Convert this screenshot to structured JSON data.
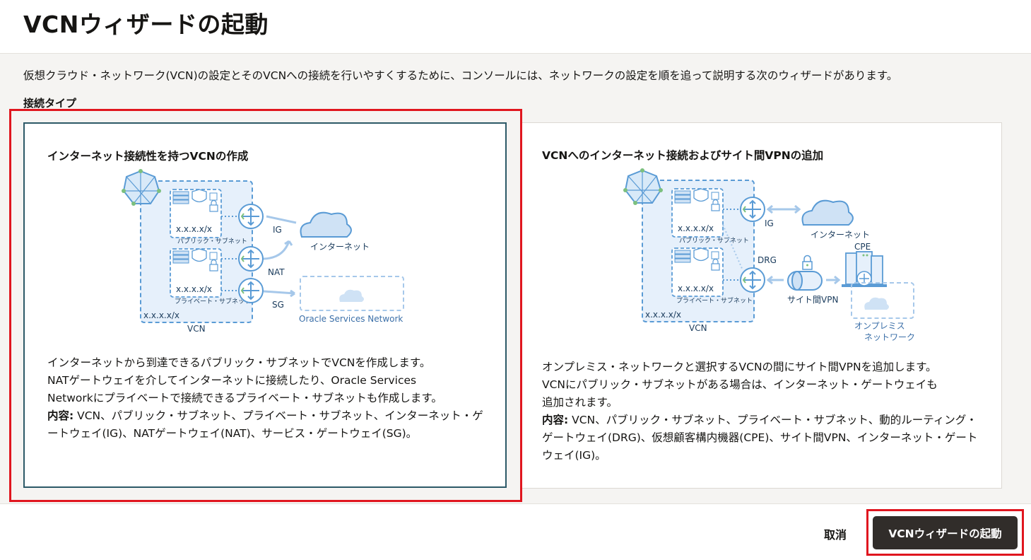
{
  "header": {
    "title": "VCNウィザードの起動"
  },
  "description": "仮想クラウド・ネットワーク(VCN)の設定とそのVCNへの接続を行いやすくするために、コンソールには、ネットワークの設定を順を追って説明する次のウィザードがあります。",
  "section_label": "接続タイプ",
  "cards": [
    {
      "title": "インターネット接続性を持つVCNの作成",
      "text_lines": [
        "インターネットから到達できるパブリック・サブネットでVCNを作成します。",
        "NATゲートウェイを介してインターネットに接続したり、Oracle Services",
        "Networkにプライベートで接続できるプライベート・サブネットも作成します。"
      ],
      "content_label": "内容:",
      "content_text": " VCN、パブリック・サブネット、プライベート・サブネット、インターネット・ゲートウェイ(IG)、NATゲートウェイ(NAT)、サービス・ゲートウェイ(SG)。",
      "diagram": {
        "cidr_public": "x.x.x.x/x",
        "public_subnet": "パブリック・サブネット",
        "cidr_private": "x.x.x.x/x",
        "private_subnet": "プライベート・サブネット",
        "cidr_vcn": "x.x.x.x/x",
        "vcn": "VCN",
        "ig": "IG",
        "nat": "NAT",
        "sg": "SG",
        "internet": "インターネット",
        "osn": "Oracle Services Network"
      }
    },
    {
      "title": "VCNへのインターネット接続およびサイト間VPNの追加",
      "text_lines": [
        "オンプレミス・ネットワークと選択するVCNの間にサイト間VPNを追加します。",
        "VCNにパブリック・サブネットがある場合は、インターネット・ゲートウェイも",
        "追加されます。"
      ],
      "content_label": "内容:",
      "content_text": " VCN、パブリック・サブネット、プライベート・サブネット、動的ルーティング・ゲートウェイ(DRG)、仮想顧客構内機器(CPE)、サイト間VPN、インターネット・ゲートウェイ(IG)。",
      "diagram": {
        "cidr_public": "x.x.x.x/x",
        "public_subnet": "パブリック・サブネット",
        "cidr_private": "x.x.x.x/x",
        "private_subnet": "プライベート・サブネット",
        "cidr_vcn": "x.x.x.x/x",
        "vcn": "VCN",
        "ig": "IG",
        "drg": "DRG",
        "internet": "インターネット",
        "cpe": "CPE",
        "vpn": "サイト間VPN",
        "onprem_line1": "オンプレミス",
        "onprem_line2": "ネットワーク"
      }
    }
  ],
  "footer": {
    "cancel_label": "取消",
    "launch_label": "VCNウィザードの起動"
  },
  "colors": {
    "primary_button": "#312d2a",
    "selected_border": "#2c5967",
    "highlight": "#e0161f",
    "diagram_blue": "#5a9bd5"
  }
}
